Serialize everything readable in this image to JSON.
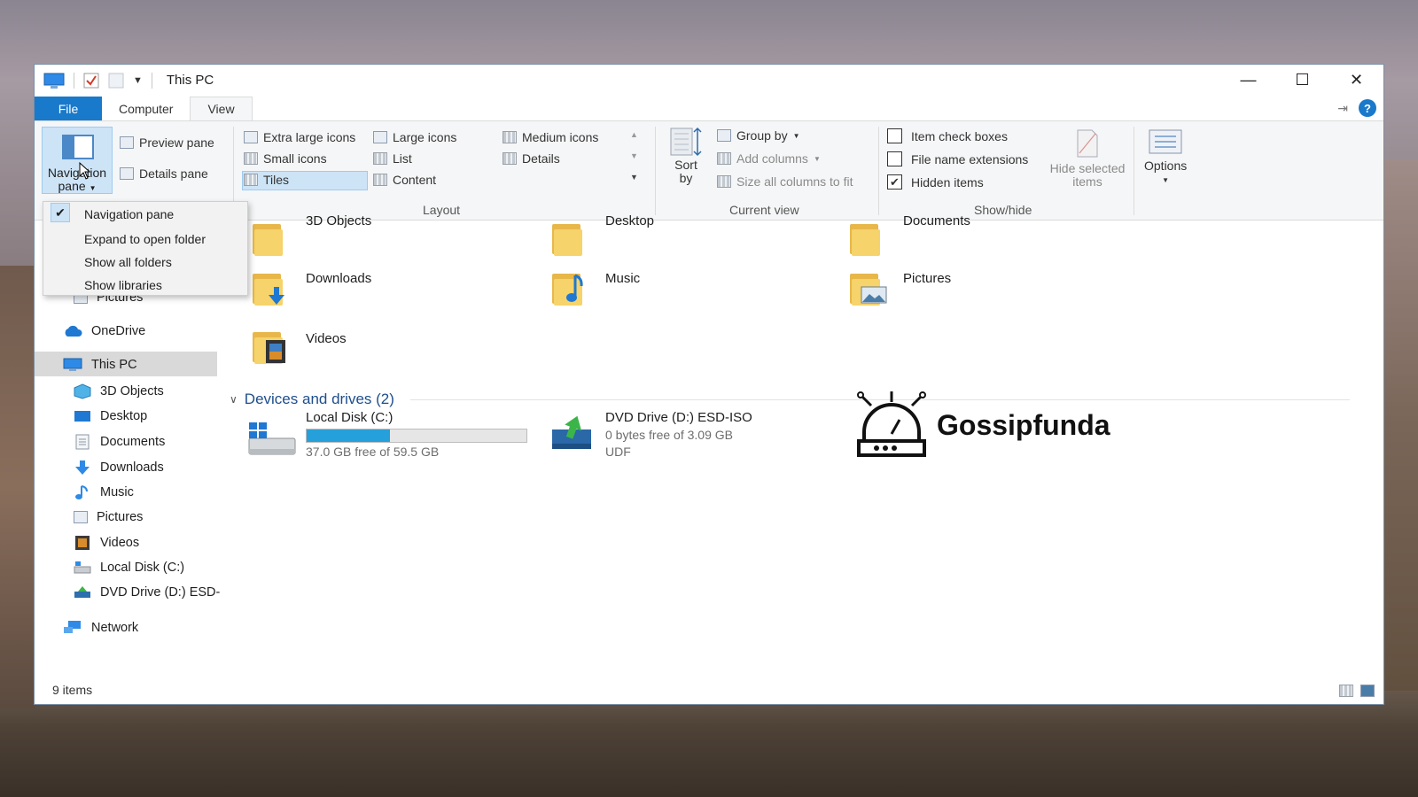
{
  "window": {
    "title": "This PC"
  },
  "tabs": {
    "file": "File",
    "computer": "Computer",
    "view": "View"
  },
  "ribbon": {
    "panes": {
      "navigation_pane": "Navigation pane",
      "preview_pane": "Preview pane",
      "details_pane": "Details pane"
    },
    "layout": {
      "label": "Layout",
      "extra_large_icons": "Extra large icons",
      "large_icons": "Large icons",
      "medium_icons": "Medium icons",
      "small_icons": "Small icons",
      "list": "List",
      "details": "Details",
      "tiles": "Tiles",
      "content": "Content",
      "selected": "Tiles"
    },
    "current_view": {
      "label": "Current view",
      "sort_by": "Sort by",
      "group_by": "Group by",
      "add_columns": "Add columns",
      "size_all_columns": "Size all columns to fit"
    },
    "show_hide": {
      "label": "Show/hide",
      "item_check_boxes": {
        "label": "Item check boxes",
        "checked": false
      },
      "file_name_extensions": {
        "label": "File name extensions",
        "checked": false
      },
      "hidden_items": {
        "label": "Hidden items",
        "checked": true
      },
      "hide_selected": "Hide selected items"
    },
    "options": "Options"
  },
  "dropdown": {
    "items": [
      "Navigation pane",
      "Expand to open folder",
      "Show all folders",
      "Show libraries"
    ],
    "checked": "Navigation pane"
  },
  "nav": {
    "pictures_pinned": "Pictures",
    "onedrive": "OneDrive",
    "this_pc": "This PC",
    "children": [
      "3D Objects",
      "Desktop",
      "Documents",
      "Downloads",
      "Music",
      "Pictures",
      "Videos",
      "Local Disk (C:)",
      "DVD Drive (D:) ESD-"
    ],
    "network": "Network"
  },
  "folders": {
    "items": [
      "3D Objects",
      "Desktop",
      "Documents",
      "Downloads",
      "Music",
      "Pictures",
      "Videos"
    ]
  },
  "devices": {
    "header": "Devices and drives (2)",
    "local_disk": {
      "name": "Local Disk (C:)",
      "free": "37.0 GB free of 59.5 GB",
      "used_fraction": 0.378
    },
    "dvd": {
      "name": "DVD Drive (D:) ESD-ISO",
      "free": "0 bytes free of 3.09 GB",
      "fs": "UDF"
    }
  },
  "status": {
    "items": "9 items"
  },
  "watermark": {
    "text": "Gossipfunda"
  },
  "colors": {
    "accent": "#1979ca",
    "selection": "#cde4f7",
    "drive_bar": "#26a0da"
  }
}
